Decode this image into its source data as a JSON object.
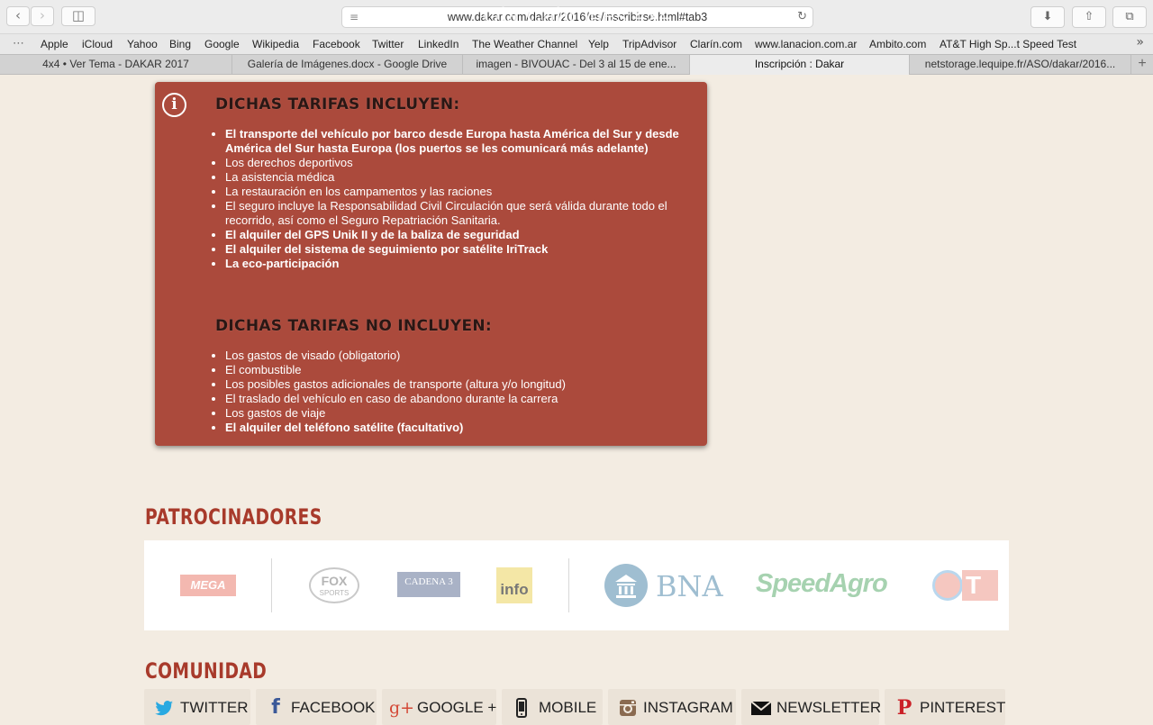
{
  "browser": {
    "url": "www.dakar.com/dakar/2016/es/inscribirse.html#tab3",
    "url_overlay": "Ola Cabrones 4x4",
    "bookmarks": [
      "Apple",
      "iCloud",
      "Yahoo",
      "Bing",
      "Google",
      "Wikipedia",
      "Facebook",
      "Twitter",
      "LinkedIn",
      "The Weather Channel",
      "Yelp",
      "TripAdvisor",
      "Clarín.com",
      "www.lanacion.com.ar",
      "Ambito.com",
      "AT&T High Sp...t Speed Test"
    ],
    "tabs": [
      {
        "label": "4x4 • Ver Tema - DAKAR 2017",
        "active": false
      },
      {
        "label": "Galería de Imágenes.docx - Google Drive",
        "active": false
      },
      {
        "label": "imagen - BIVOUAC - Del 3 al 15 de ene...",
        "active": false
      },
      {
        "label": "Inscripción : Dakar",
        "active": true
      },
      {
        "label": "netstorage.lequipe.fr/ASO/dakar/2016...",
        "active": false
      }
    ]
  },
  "info_box": {
    "include_heading": "DICHAS TARIFAS INCLUYEN:",
    "include_items": [
      {
        "text": "El transporte del vehículo por barco desde Europa hasta América del Sur y desde América del Sur hasta Europa (los puertos se les comunicará más adelante)",
        "bold": true
      },
      {
        "text": "Los derechos deportivos",
        "bold": false
      },
      {
        "text": "La asistencia médica",
        "bold": false
      },
      {
        "text": "La restauración en los campamentos y las raciones",
        "bold": false
      },
      {
        "text": "El seguro incluye la Responsabilidad Civil Circulación que será válida durante todo el recorrido, así como el Seguro Repatriación Sanitaria.",
        "bold": false
      },
      {
        "text": "El alquiler del GPS Unik II y de la baliza de seguridad",
        "bold": true
      },
      {
        "text": "El alquiler del sistema de seguimiento por satélite IriTrack",
        "bold": true
      },
      {
        "text": "La eco-participación",
        "bold": true
      }
    ],
    "exclude_heading": "DICHAS TARIFAS NO INCLUYEN:",
    "exclude_items": [
      {
        "text": "Los gastos de visado (obligatorio)",
        "bold": false
      },
      {
        "text": "El combustible",
        "bold": false
      },
      {
        "text": "Los posibles gastos adicionales de transporte (altura y/o longitud)",
        "bold": false
      },
      {
        "text": "El traslado del vehículo en caso de abandono durante la carrera",
        "bold": false
      },
      {
        "text": "Los gastos de viaje",
        "bold": false
      },
      {
        "text": "El alquiler del teléfono satélite (facultativo)",
        "bold": true
      }
    ]
  },
  "sponsors_section": {
    "title": "PATROCINADORES",
    "logos": {
      "mega": "MEGA",
      "fox_top": "FOX",
      "fox_bottom": "SPORTS",
      "cadena3": "CADENA 3",
      "info": "info",
      "bna": "BNA",
      "speedagro": "SpeedAgro",
      "total": "T"
    }
  },
  "community_section": {
    "title": "COMUNIDAD",
    "buttons": [
      {
        "label": "TWITTER",
        "icon": "twitter-icon",
        "color": "#29a9e1"
      },
      {
        "label": "FACEBOOK",
        "icon": "facebook-icon",
        "color": "#3b5998"
      },
      {
        "label": "GOOGLE +",
        "icon": "google-plus-icon",
        "color": "#d34836"
      },
      {
        "label": "MOBILE",
        "icon": "mobile-icon",
        "color": "#222222"
      },
      {
        "label": "INSTAGRAM",
        "icon": "instagram-icon",
        "color": "#8a6a50"
      },
      {
        "label": "NEWSLETTER",
        "icon": "envelope-icon",
        "color": "#111111"
      },
      {
        "label": "PINTEREST",
        "icon": "pinterest-icon",
        "color": "#cb2027"
      }
    ]
  },
  "colors": {
    "accent": "#a83a2b",
    "box": "#ab4a3c",
    "page_bg": "#f3ece2"
  }
}
